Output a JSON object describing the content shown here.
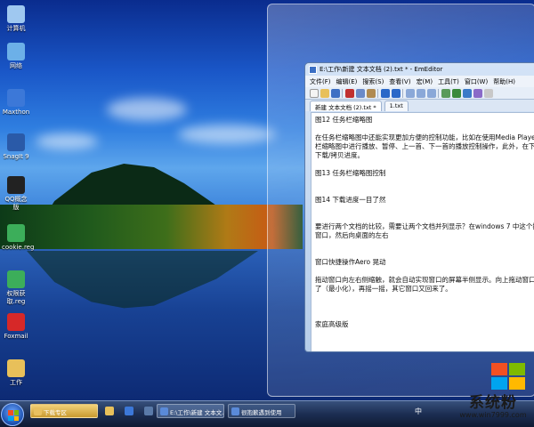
{
  "desktop": {
    "icons": [
      {
        "label": "计算机",
        "icon": "computer-icon",
        "color": "#9fc8f0"
      },
      {
        "label": "网络",
        "icon": "network-icon",
        "color": "#6cb0e8"
      },
      {
        "label": "Maxthon",
        "icon": "maxthon-browser-icon",
        "color": "#3c78d8"
      },
      {
        "label": "SnagIt 9",
        "icon": "snagit-icon",
        "color": "#2a5aa8"
      },
      {
        "label": "QQ概念版",
        "icon": "qq-penguin-icon",
        "color": "#222222"
      },
      {
        "label": "cookie.reg",
        "icon": "reg-file-icon",
        "color": "#3cae5a"
      },
      {
        "label": "权限获取.reg",
        "icon": "reg-file-icon",
        "color": "#3cae5a"
      },
      {
        "label": "Foxmail",
        "icon": "foxmail-icon",
        "color": "#d62828"
      },
      {
        "label": "工作",
        "icon": "folder-icon",
        "color": "#e8c05a"
      }
    ]
  },
  "editor": {
    "title": "E:\\工作\\新建 文本文档 (2).txt * - EmEditor",
    "menu": [
      "文件(F)",
      "编辑(E)",
      "搜索(S)",
      "查看(V)",
      "宏(M)",
      "工具(T)",
      "窗口(W)",
      "帮助(H)"
    ],
    "tabs": [
      "新建 文本文档 (2).txt *",
      "1.txt"
    ],
    "lines": [
      "图12 任务栏缩略图",
      "",
      "在任务栏缩略图中还能实现更加方便的控制功能，比如在使用Media Player",
      "栏缩略图中进行播放、暂停、上一首、下一首的播放控制操作，此外，在下",
      "下载/拷贝进度。",
      "",
      "图13 任务栏缩略图控制",
      "",
      "",
      "图14 下载进度一目了然",
      "",
      "",
      "要进行两个文档的比较，需要让两个文档并列显示？在windows 7 中这个操",
      "窗口，然后向桌面的左右",
      "",
      "",
      "窗口快捷操作Aero 晃动",
      "",
      "拖动窗口向左右侧缩触，就会自动实现窗口的屏幕半侧显示。向上拖动窗口",
      "了（最小化），再摇一摇，其它窗口又回来了。",
      "",
      "",
      "",
      "家庭高级版"
    ]
  },
  "taskbar": {
    "buttons": [
      {
        "label": "下载专区",
        "color": "#e8c060"
      },
      {
        "label": "E:\\工作\\新建 文本文...",
        "color": "#5a8ad8"
      },
      {
        "label": "很抱歉遇到使用",
        "color": "#5a8ad8"
      }
    ],
    "tray_text": "中"
  },
  "watermark": {
    "title": "系统粉",
    "url": "www.win7999.com",
    "colors": [
      "#f25022",
      "#7fba00",
      "#00a4ef",
      "#ffb900"
    ]
  }
}
